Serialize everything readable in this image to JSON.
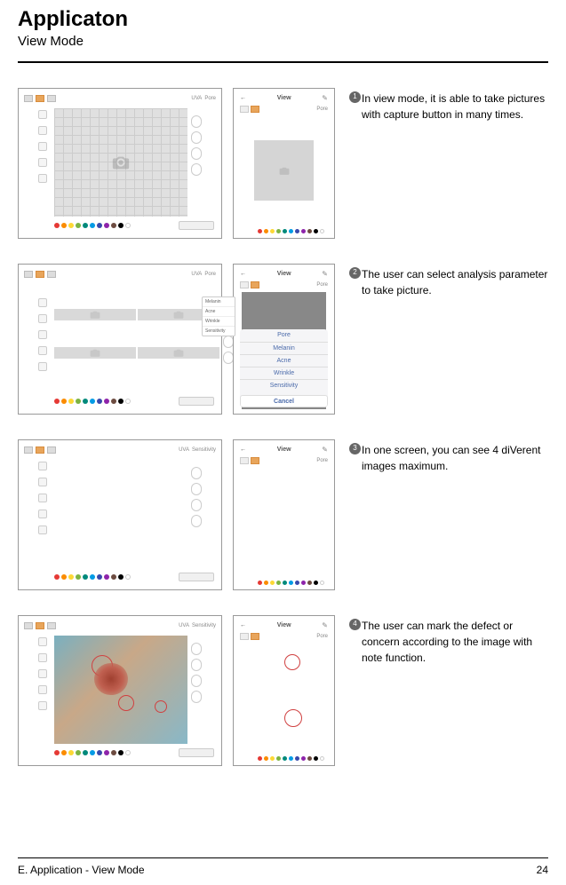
{
  "header": {
    "title": "Applicaton",
    "subtitle": "View Mode"
  },
  "colors": {
    "dots": [
      "#e53935",
      "#fb8c00",
      "#fdd835",
      "#7cb342",
      "#00897b",
      "#039be5",
      "#3949ab",
      "#8e24aa",
      "#6d4c41",
      "#000000",
      "#ffffff"
    ]
  },
  "phone": {
    "view_label": "View",
    "sub_label": "Pore"
  },
  "sheet": {
    "items": [
      "Pore",
      "Melanin",
      "Acne",
      "Wrinkle",
      "Sensitivity"
    ],
    "cancel": "Cancel"
  },
  "dropdown": {
    "items": [
      "Melanin",
      "Acne",
      "Wrinkle",
      "Sensitivity"
    ]
  },
  "steps": [
    {
      "num": "1",
      "text": "In view mode, it is able to take pictures with capture button in many times."
    },
    {
      "num": "2",
      "text": "The user can select analysis parameter to take picture."
    },
    {
      "num": "3",
      "text": "In one screen, you can see 4 diVerent images maximum."
    },
    {
      "num": "4",
      "text": "The user can mark the defect or concern according to the image with note function."
    }
  ],
  "footer": {
    "left": "E. Application - View Mode",
    "right": "24"
  }
}
